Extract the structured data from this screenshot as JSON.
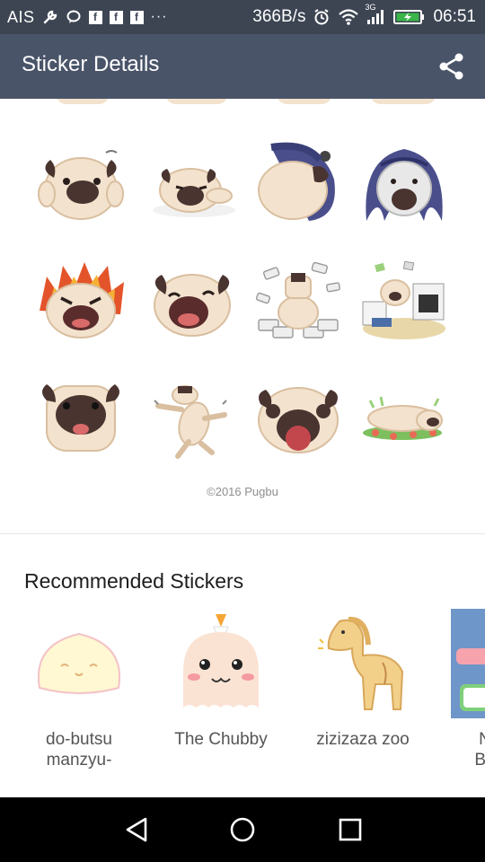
{
  "status_bar": {
    "carrier": "AIS",
    "speed": "366B/s",
    "network": "3G",
    "time": "06:51",
    "icons": [
      "wrench-icon",
      "chat-icon",
      "facebook-icon",
      "facebook-icon",
      "facebook-icon",
      "more-dots-icon",
      "alarm-icon",
      "wifi-icon",
      "signal-icon",
      "battery-charging-icon"
    ]
  },
  "app_bar": {
    "title": "Sticker Details",
    "share_icon": "share-icon"
  },
  "sticker_grid": {
    "stickers": [
      "pug-hands-on-ears-sticker",
      "pug-lying-sticker",
      "pug-hidden-face-sticker",
      "pug-scared-hair-sticker",
      "pug-angry-fire-sticker",
      "pug-laughing-sticker",
      "pug-money-sticker",
      "pug-office-desk-sticker",
      "pug-face-sticker",
      "pug-dancing-sticker",
      "pug-tongue-sticker",
      "pug-lying-flowers-sticker"
    ],
    "copyright": "©2016 Pugbu"
  },
  "recommended": {
    "title": "Recommended Stickers",
    "items": [
      {
        "name": "do-butsu manzyu-",
        "thumb": "manju-sticker"
      },
      {
        "name": "The Chubby",
        "thumb": "chubby-ghost-sticker"
      },
      {
        "name": "zizizaza zoo",
        "thumb": "horse-sticker"
      },
      {
        "name": "N Ba",
        "thumb": "partial-sticker"
      }
    ],
    "partial_item_lines": [
      "N",
      "Ba"
    ]
  },
  "colors": {
    "status_bar": "#3d4553",
    "app_bar": "#4a5469",
    "background": "#ffffff",
    "nav_bar": "#000000",
    "pug_fur": "#f3e2cd",
    "pug_mask": "#4a3430"
  },
  "nav_bar": {
    "buttons": [
      "back-triangle-icon",
      "home-circle-icon",
      "recents-square-icon"
    ]
  }
}
